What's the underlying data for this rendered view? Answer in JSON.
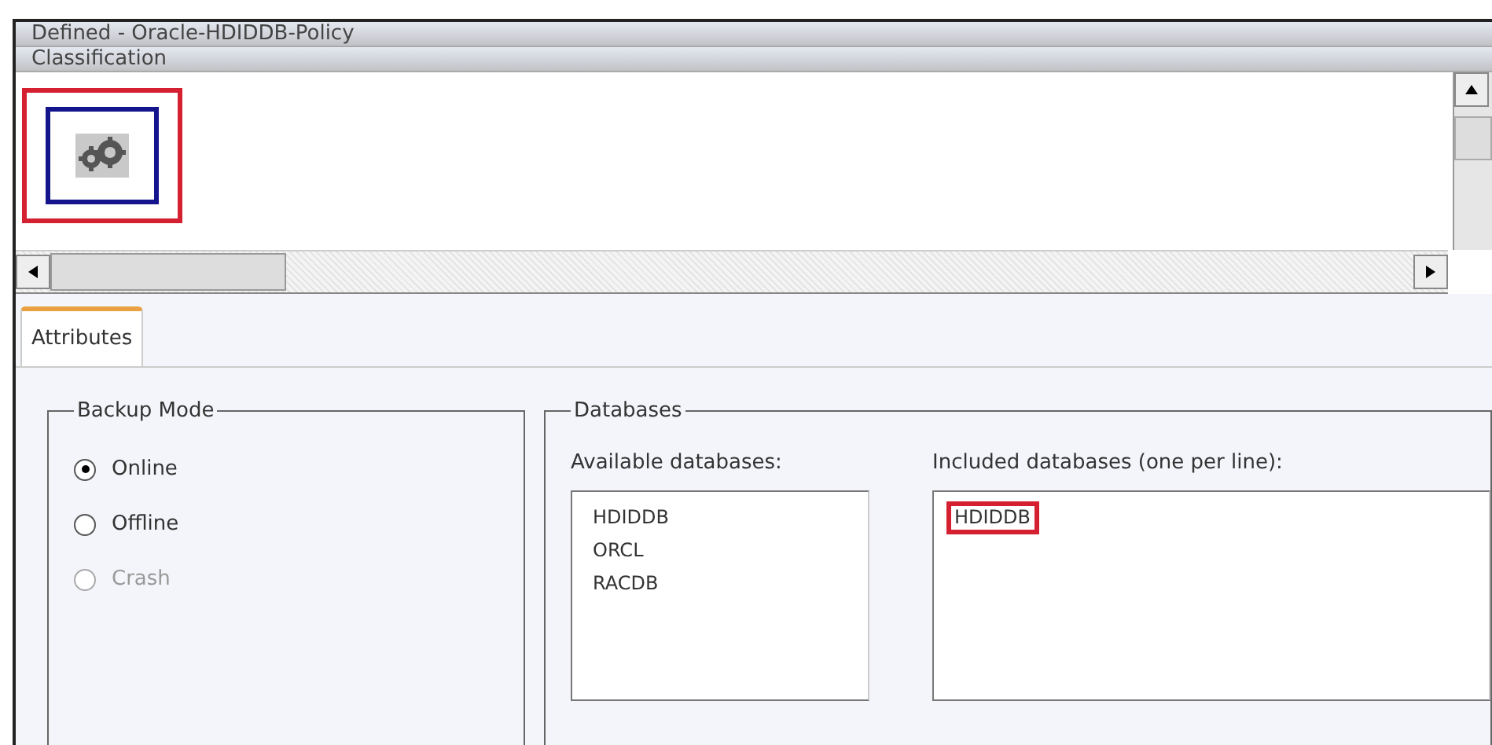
{
  "window": {
    "title": "Defined - Oracle-HDIDDB-Policy"
  },
  "classification": {
    "header": "Classification",
    "items": [
      {
        "kind": "policy",
        "highlighted": true
      }
    ]
  },
  "tabs": [
    {
      "label": "Attributes",
      "selected": true
    }
  ],
  "backup_mode": {
    "title": "Backup Mode",
    "options": [
      {
        "label": "Online",
        "selected": true,
        "disabled": false
      },
      {
        "label": "Offline",
        "selected": false,
        "disabled": false
      },
      {
        "label": "Crash",
        "selected": false,
        "disabled": true
      }
    ]
  },
  "databases": {
    "title": "Databases",
    "available": {
      "label": "Available databases:",
      "items": [
        {
          "text": "HDIDDB",
          "highlighted": false
        },
        {
          "text": "ORCL",
          "highlighted": false
        },
        {
          "text": "RACDB",
          "highlighted": false
        }
      ]
    },
    "included": {
      "label": "Included databases (one per line):",
      "items": [
        {
          "text": "HDIDDB",
          "highlighted": true
        }
      ]
    }
  }
}
